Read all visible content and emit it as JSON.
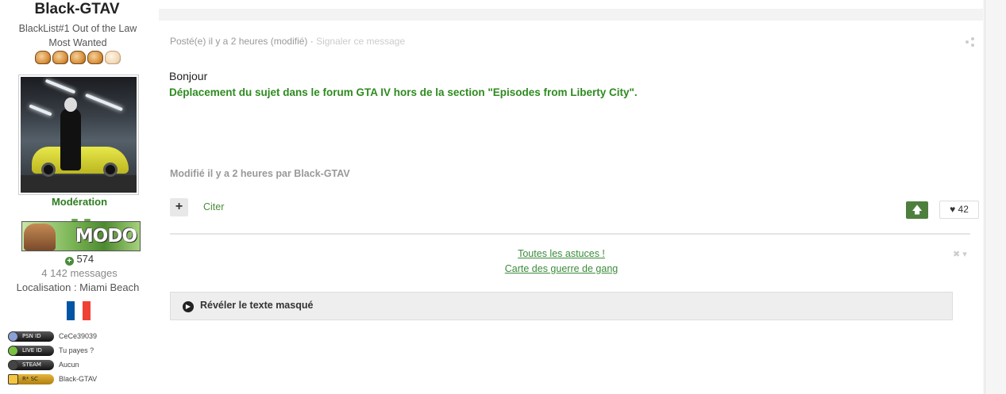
{
  "author": {
    "name": "Black-GTAV",
    "title_line1": "BlackList#1 Out of the Law",
    "title_line2": "Most Wanted",
    "group": "Modération",
    "rank_badge_text": "MODO",
    "reputation": "574",
    "messages": "4 142 messages",
    "location": "Localisation : Miami Beach",
    "flag_colors": [
      "#0055a4",
      "#ffffff",
      "#ef4135"
    ],
    "gamer_ids": [
      {
        "badge": "PSN ID",
        "value": "CeCe39039",
        "icon": "playstation-icon"
      },
      {
        "badge": "LIVE ID",
        "value": "Tu payes ?",
        "icon": "xbox-icon"
      },
      {
        "badge": "STEAM",
        "value": "Aucun",
        "icon": "steam-icon"
      },
      {
        "badge": "R* SC",
        "value": "Black-GTAV",
        "icon": "rockstar-icon"
      }
    ]
  },
  "post": {
    "meta_posted": "Posté(e) il y a 2 heures (modifié)",
    "meta_separator": " · ",
    "meta_report": "Signaler ce message",
    "greeting": "Bonjour",
    "moved_notice": "Déplacement du sujet dans le forum GTA IV hors de la section \"Episodes from Liberty City\".",
    "edited_by": "Modifié il y a 2 heures par Black-GTAV",
    "multiquote_label": "+",
    "quote_label": "Citer",
    "like_count": "42"
  },
  "ad": {
    "link1": "Toutes les astuces !",
    "link2": "Carte des guerre de gang",
    "close_label": "✖ ▾"
  },
  "spoiler": {
    "label": "Révéler le texte masqué"
  },
  "colors": {
    "accent_green": "#2e8b1f",
    "link_green": "#3c8c3c",
    "button_green": "#4e7f3e"
  }
}
